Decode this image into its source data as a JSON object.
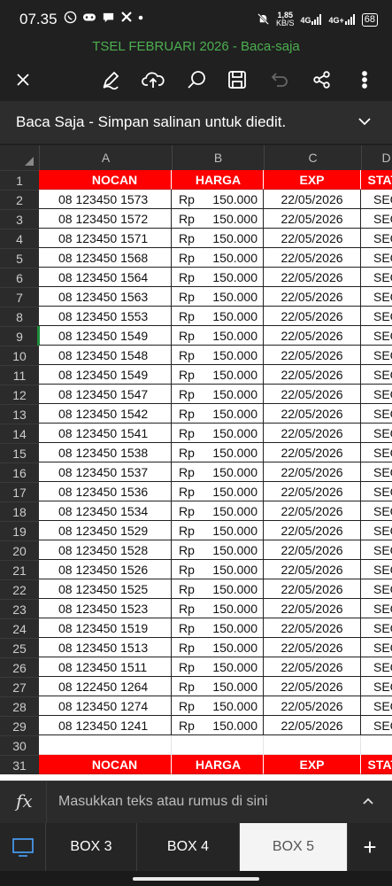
{
  "status_bar": {
    "time": "07.35",
    "notif_icons": [
      "whatsapp-icon",
      "gamepad-icon",
      "chat-icon",
      "x-icon",
      "dot-icon"
    ],
    "net_speed_value": "1,85",
    "net_speed_unit": "KB/S",
    "signal_1": "4G",
    "signal_2": "4G+",
    "battery": "68"
  },
  "document": {
    "title": "TSEL FEBRUARI 2026 - Baca-saja"
  },
  "toolbar": {
    "icons": [
      "close-icon",
      "pen-icon",
      "cloud-upload-icon",
      "search-icon",
      "save-icon",
      "undo-icon",
      "share-icon",
      "more-icon"
    ]
  },
  "banner": {
    "text": "Baca Saja - Simpan salinan untuk diedit."
  },
  "grid": {
    "columns": [
      "A",
      "B",
      "C",
      "D"
    ],
    "header": {
      "a": "NOCAN",
      "b": "HARGA",
      "c": "EXP",
      "d": "STATUS"
    },
    "rows": [
      {
        "n": "2",
        "a": "08 123450 1573",
        "cur": "Rp",
        "b": "150.000",
        "c": "22/05/2026",
        "d": "SEGEL"
      },
      {
        "n": "3",
        "a": "08 123450 1572",
        "cur": "Rp",
        "b": "150.000",
        "c": "22/05/2026",
        "d": "SEGEL"
      },
      {
        "n": "4",
        "a": "08 123450 1571",
        "cur": "Rp",
        "b": "150.000",
        "c": "22/05/2026",
        "d": "SEGEL"
      },
      {
        "n": "5",
        "a": "08 123450 1568",
        "cur": "Rp",
        "b": "150.000",
        "c": "22/05/2026",
        "d": "SEGEL"
      },
      {
        "n": "6",
        "a": "08 123450 1564",
        "cur": "Rp",
        "b": "150.000",
        "c": "22/05/2026",
        "d": "SEGEL"
      },
      {
        "n": "7",
        "a": "08 123450 1563",
        "cur": "Rp",
        "b": "150.000",
        "c": "22/05/2026",
        "d": "SEGEL"
      },
      {
        "n": "8",
        "a": "08 123450 1553",
        "cur": "Rp",
        "b": "150.000",
        "c": "22/05/2026",
        "d": "SEGEL"
      },
      {
        "n": "9",
        "a": "08 123450 1549",
        "cur": "Rp",
        "b": "150.000",
        "c": "22/05/2026",
        "d": "SEGEL"
      },
      {
        "n": "10",
        "a": "08 123450 1548",
        "cur": "Rp",
        "b": "150.000",
        "c": "22/05/2026",
        "d": "SEGEL"
      },
      {
        "n": "11",
        "a": "08 123450 1549",
        "cur": "Rp",
        "b": "150.000",
        "c": "22/05/2026",
        "d": "SEGEL"
      },
      {
        "n": "12",
        "a": "08 123450 1547",
        "cur": "Rp",
        "b": "150.000",
        "c": "22/05/2026",
        "d": "SEGEL"
      },
      {
        "n": "13",
        "a": "08 123450 1542",
        "cur": "Rp",
        "b": "150.000",
        "c": "22/05/2026",
        "d": "SEGEL"
      },
      {
        "n": "14",
        "a": "08 123450 1541",
        "cur": "Rp",
        "b": "150.000",
        "c": "22/05/2026",
        "d": "SEGEL"
      },
      {
        "n": "15",
        "a": "08 123450 1538",
        "cur": "Rp",
        "b": "150.000",
        "c": "22/05/2026",
        "d": "SEGEL"
      },
      {
        "n": "16",
        "a": "08 123450 1537",
        "cur": "Rp",
        "b": "150.000",
        "c": "22/05/2026",
        "d": "SEGEL"
      },
      {
        "n": "17",
        "a": "08 123450 1536",
        "cur": "Rp",
        "b": "150.000",
        "c": "22/05/2026",
        "d": "SEGEL"
      },
      {
        "n": "18",
        "a": "08 123450 1534",
        "cur": "Rp",
        "b": "150.000",
        "c": "22/05/2026",
        "d": "SEGEL"
      },
      {
        "n": "19",
        "a": "08 123450 1529",
        "cur": "Rp",
        "b": "150.000",
        "c": "22/05/2026",
        "d": "SEGEL"
      },
      {
        "n": "20",
        "a": "08 123450 1528",
        "cur": "Rp",
        "b": "150.000",
        "c": "22/05/2026",
        "d": "SEGEL"
      },
      {
        "n": "21",
        "a": "08 123450 1526",
        "cur": "Rp",
        "b": "150.000",
        "c": "22/05/2026",
        "d": "SEGEL"
      },
      {
        "n": "22",
        "a": "08 123450 1525",
        "cur": "Rp",
        "b": "150.000",
        "c": "22/05/2026",
        "d": "SEGEL"
      },
      {
        "n": "23",
        "a": "08 123450 1523",
        "cur": "Rp",
        "b": "150.000",
        "c": "22/05/2026",
        "d": "SEGEL"
      },
      {
        "n": "24",
        "a": "08 123450 1519",
        "cur": "Rp",
        "b": "150.000",
        "c": "22/05/2026",
        "d": "SEGEL"
      },
      {
        "n": "25",
        "a": "08 123450 1513",
        "cur": "Rp",
        "b": "150.000",
        "c": "22/05/2026",
        "d": "SEGEL"
      },
      {
        "n": "26",
        "a": "08 123450 1511",
        "cur": "Rp",
        "b": "150.000",
        "c": "22/05/2026",
        "d": "SEGEL"
      },
      {
        "n": "27",
        "a": "08 122450 1264",
        "cur": "Rp",
        "b": "150.000",
        "c": "22/05/2026",
        "d": "SEGEL"
      },
      {
        "n": "28",
        "a": "08 123450 1274",
        "cur": "Rp",
        "b": "150.000",
        "c": "22/05/2026",
        "d": "SEGEL"
      },
      {
        "n": "29",
        "a": "08 123450 1241",
        "cur": "Rp",
        "b": "150.000",
        "c": "22/05/2026",
        "d": "SEGEL"
      }
    ],
    "empty_row_n": "30",
    "second_header_n": "31",
    "first_header_n": "1",
    "colors": {
      "header_bg": "#ff0000",
      "header_text": "#ffffff",
      "selection": "#1e8e3e"
    }
  },
  "formula_bar": {
    "fx": "fx",
    "placeholder": "Masukkan teks atau rumus di sini"
  },
  "sheet_tabs": {
    "tabs": [
      "BOX 3",
      "BOX 4",
      "BOX 5"
    ],
    "active": "BOX 5",
    "add_label": "+"
  }
}
